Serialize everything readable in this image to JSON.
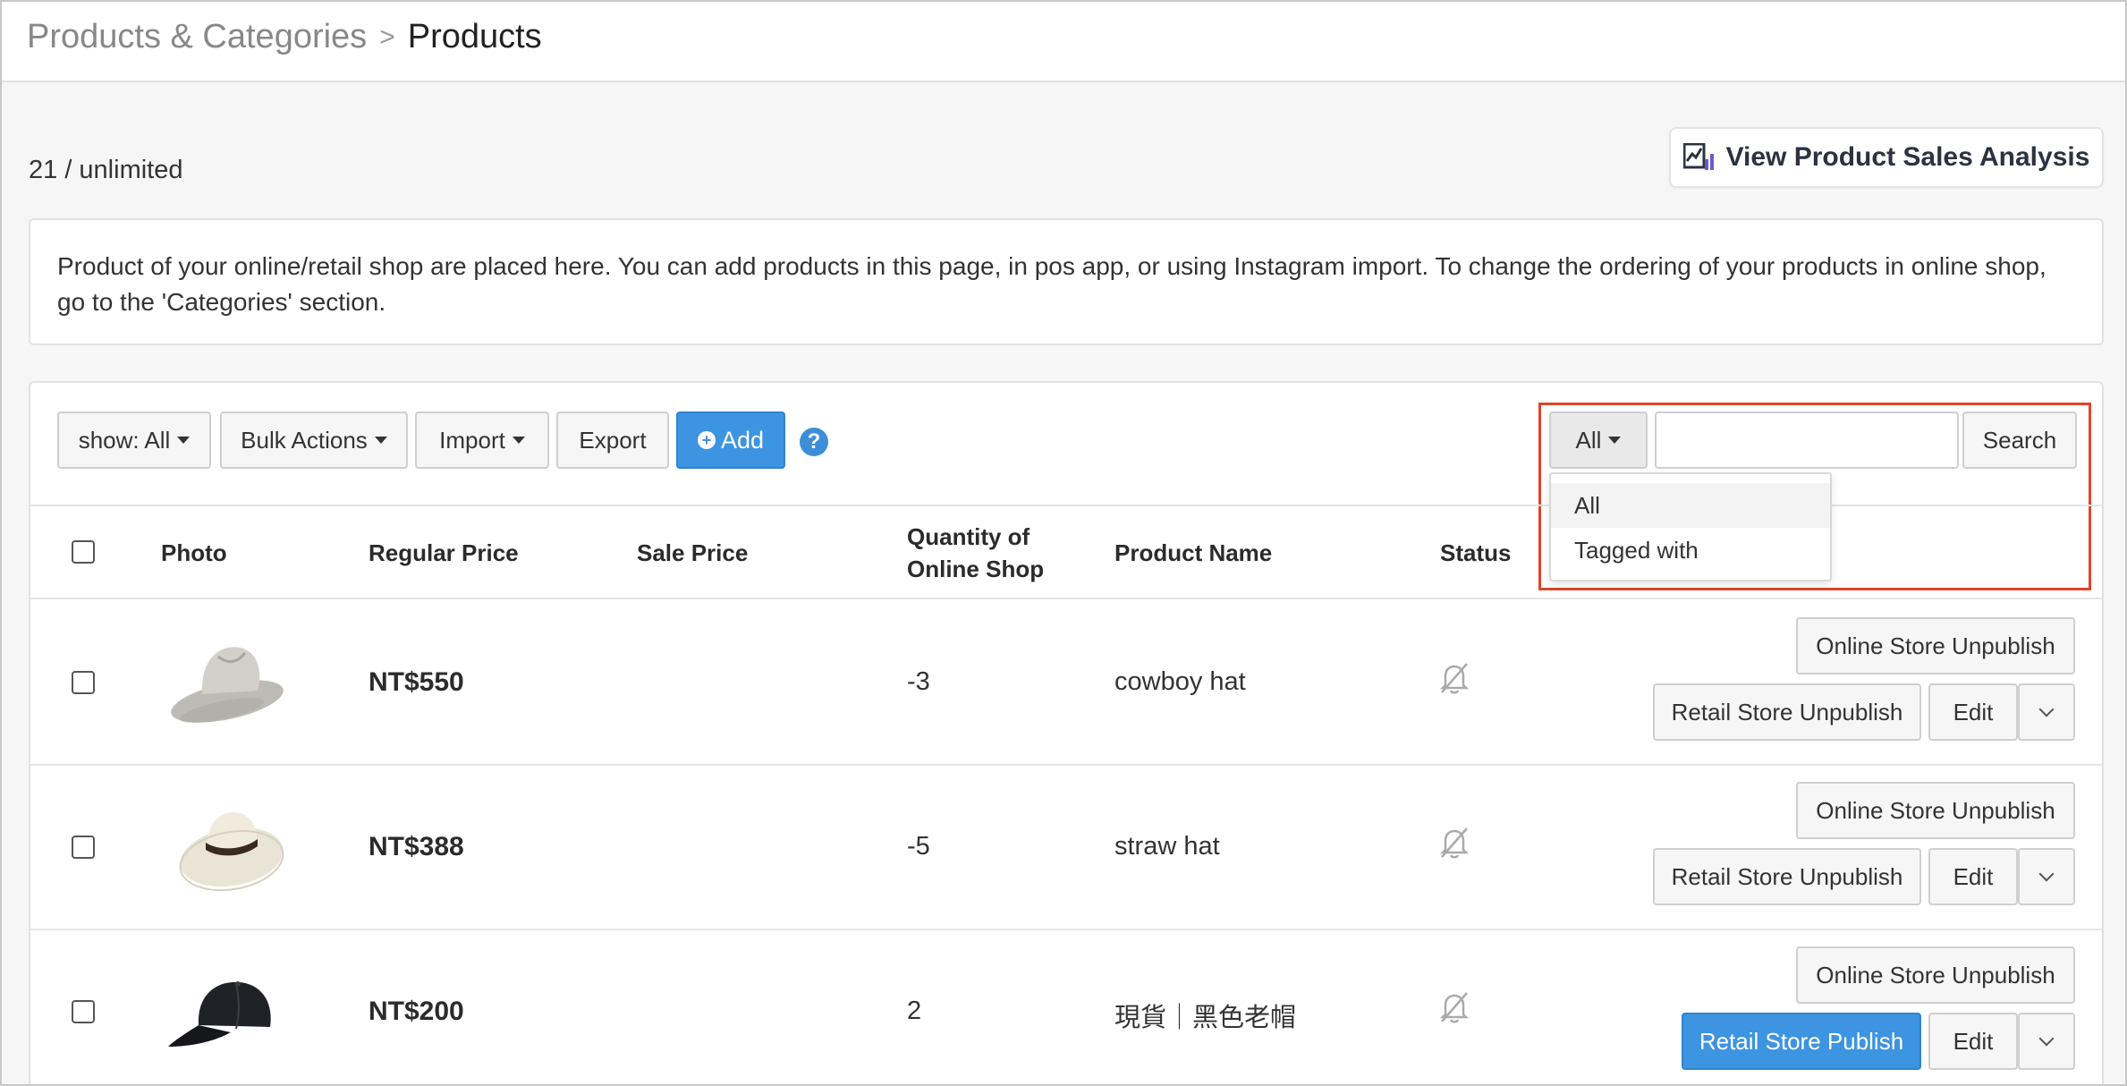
{
  "breadcrumb": {
    "parent": "Products & Categories",
    "separator": ">",
    "current": "Products"
  },
  "quota": "21 / unlimited",
  "analysis_button": {
    "label": "View Product Sales Analysis"
  },
  "info_text": "Product of your online/retail shop are placed here. You can add products in this page, in pos app, or using Instagram import. To change the ordering of your products in online shop, go to the 'Categories' section.",
  "toolbar": {
    "show_label": "show: All",
    "bulk_label": "Bulk Actions",
    "import_label": "Import",
    "export_label": "Export",
    "add_label": "Add",
    "help": "?"
  },
  "search": {
    "filter_label": "All",
    "input_value": "",
    "button_label": "Search",
    "options": [
      "All",
      "Tagged with"
    ]
  },
  "table": {
    "columns": [
      "Photo",
      "Regular Price",
      "Sale Price",
      "Quantity of",
      "Online Shop",
      "Product Name",
      "Status"
    ],
    "rows": [
      {
        "regular_price": "NT$550",
        "sale_price": "",
        "quantity": "-3",
        "name": "cowboy hat",
        "online_action": "Online Store Unpublish",
        "retail_action": "Retail Store Unpublish",
        "edit": "Edit"
      },
      {
        "regular_price": "NT$388",
        "sale_price": "",
        "quantity": "-5",
        "name": "straw hat",
        "online_action": "Online Store Unpublish",
        "retail_action": "Retail Store Unpublish",
        "edit": "Edit"
      },
      {
        "regular_price": "NT$200",
        "sale_price": "",
        "quantity": "2",
        "name": "現貨｜黑色老帽",
        "online_action": "Online Store Unpublish",
        "retail_action": "Retail Store Publish",
        "edit": "Edit"
      }
    ]
  },
  "colors": {
    "primary": "#3d94e0",
    "highlight": "#e0442b"
  },
  "icons": {
    "analysis": "chart-icon",
    "status": "bell-off-icon",
    "more": "chevron-down-icon"
  }
}
